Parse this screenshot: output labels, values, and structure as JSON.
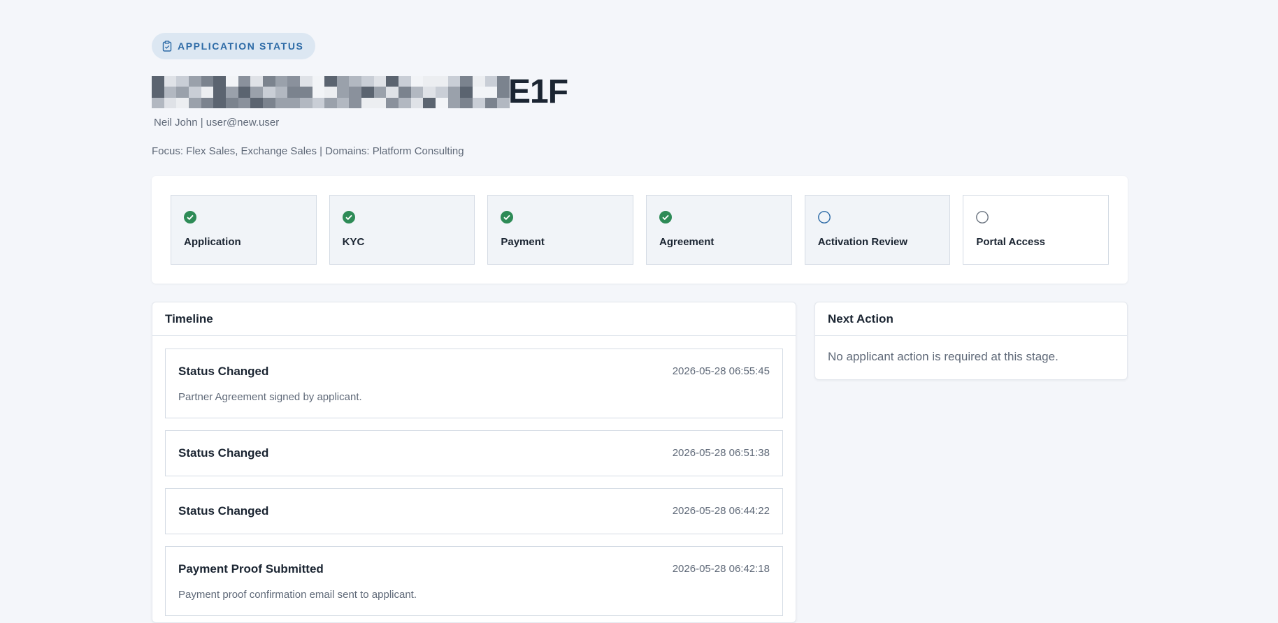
{
  "header": {
    "badge_label": "APPLICATION STATUS",
    "badge_icon": "clipboard-icon",
    "title_visible_suffix": "E1F",
    "subline": "Neil John | user@new.user",
    "focusline": "Focus: Flex Sales, Exchange Sales | Domains: Platform Consulting"
  },
  "steps": [
    {
      "label": "Application",
      "status": "complete"
    },
    {
      "label": "KYC",
      "status": "complete"
    },
    {
      "label": "Payment",
      "status": "complete"
    },
    {
      "label": "Agreement",
      "status": "complete"
    },
    {
      "label": "Activation Review",
      "status": "current"
    },
    {
      "label": "Portal Access",
      "status": "pending"
    }
  ],
  "timeline": {
    "title": "Timeline",
    "events": [
      {
        "title": "Status Changed",
        "time": "2026-05-28 06:55:45",
        "description": "Partner Agreement signed by applicant."
      },
      {
        "title": "Status Changed",
        "time": "2026-05-28 06:51:38",
        "description": ""
      },
      {
        "title": "Status Changed",
        "time": "2026-05-28 06:44:22",
        "description": ""
      },
      {
        "title": "Payment Proof Submitted",
        "time": "2026-05-28 06:42:18",
        "description": "Payment proof confirmation email sent to applicant."
      }
    ]
  },
  "next_action": {
    "title": "Next Action",
    "message": "No applicant action is required at this stage."
  },
  "colors": {
    "background": "#f4f6fa",
    "accent": "#2c6aa6",
    "badge_bg": "#dce7f2",
    "complete": "#2e8b57",
    "current_ring": "#2c6aa6",
    "pending_ring": "#6b7480"
  }
}
